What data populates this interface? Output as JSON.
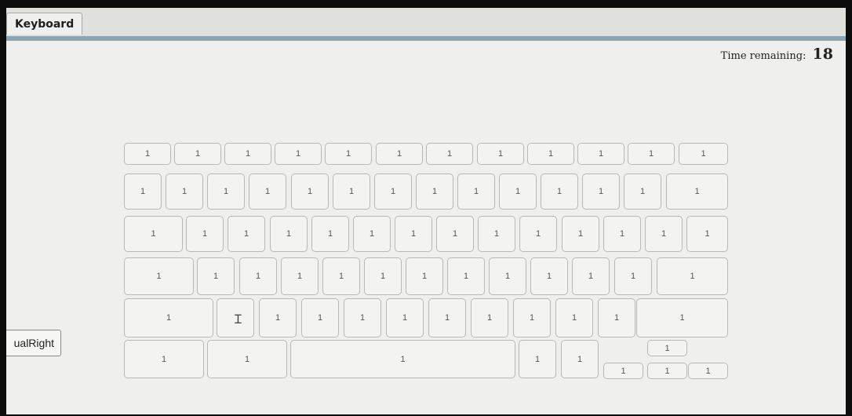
{
  "tabs": [
    {
      "label": "Keyboard"
    }
  ],
  "timer": {
    "label": "Time remaining:",
    "value": "18"
  },
  "side_button": {
    "label": "ualRight"
  },
  "keyboard": {
    "rows": [
      [
        "1",
        "1",
        "1",
        "1",
        "1",
        "1",
        "1",
        "1",
        "1",
        "1",
        "1",
        "1"
      ],
      [
        "1",
        "1",
        "1",
        "1",
        "1",
        "1",
        "1",
        "1",
        "1",
        "1",
        "1",
        "1",
        "1",
        "1"
      ],
      [
        "1",
        "1",
        "1",
        "1",
        "1",
        "1",
        "1",
        "1",
        "1",
        "1",
        "1",
        "1",
        "1",
        "1"
      ],
      [
        "1",
        "1",
        "1",
        "1",
        "1",
        "1",
        "1",
        "1",
        "1",
        "1",
        "1",
        "1",
        "1"
      ],
      [
        "1",
        "1",
        "1",
        "1",
        "1",
        "1",
        "1",
        "1",
        "1",
        "1",
        "1",
        "1"
      ],
      [
        "1",
        "1",
        "1",
        "1",
        "1",
        "1",
        "1",
        "1",
        "1"
      ]
    ]
  },
  "cursor_icon": "text-cursor-ibeam"
}
